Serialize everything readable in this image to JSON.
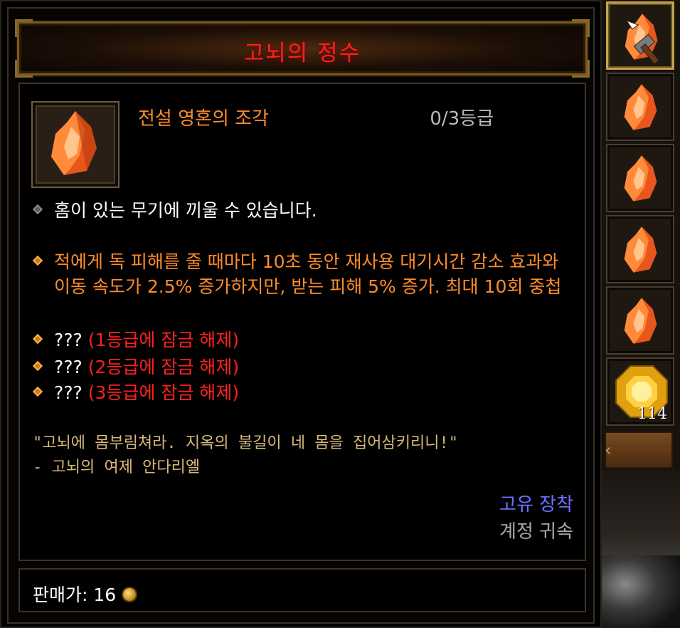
{
  "tooltip": {
    "title": "고뇌의 정수",
    "gem_name": "전설 영혼의 조각",
    "rank": "0/3등급",
    "properties": [
      {
        "text": "홈이 있는 무기에 끼울 수 있습니다."
      },
      {
        "text": "적에게 독 피해를 줄 때마다 10초 동안 재사용 대기시간 감소 효과와 이동 속도가 2.5% 증가하지만, 받는 피해 5% 증가. 최대 10회 중첩"
      },
      {
        "prefix": "???",
        "locked": " (1등급에 잠금 해제)"
      },
      {
        "prefix": "???",
        "locked": " (2등급에 잠금 해제)"
      },
      {
        "prefix": "???",
        "locked": " (3등급에 잠금 해제)"
      }
    ],
    "flavor_quote": "\"고뇌에 몸부림쳐라. 지옥의 불길이 네 몸을 집어삼키리니!\"",
    "flavor_author": "- 고뇌의 여제 안다리엘",
    "unique_equip": "고유 장착",
    "account_bound": "계정 귀속",
    "sell_label": "판매가: 16",
    "colors": {
      "title": "#ff1f1f",
      "legendary": "#ff8c2a",
      "locked": "#ff2020",
      "flavor": "#d8b878",
      "unique": "#6f6fff"
    }
  },
  "inventory": {
    "slots": [
      {
        "icon": "legendary-gem-icon",
        "overlay": "hammer-cursor-icon",
        "selected": true
      },
      {
        "icon": "legendary-gem-icon"
      },
      {
        "icon": "legendary-gem-icon"
      },
      {
        "icon": "legendary-gem-icon"
      },
      {
        "icon": "legendary-gem-icon"
      },
      {
        "icon": "topaz-gem-icon",
        "quantity": "114"
      }
    ]
  }
}
